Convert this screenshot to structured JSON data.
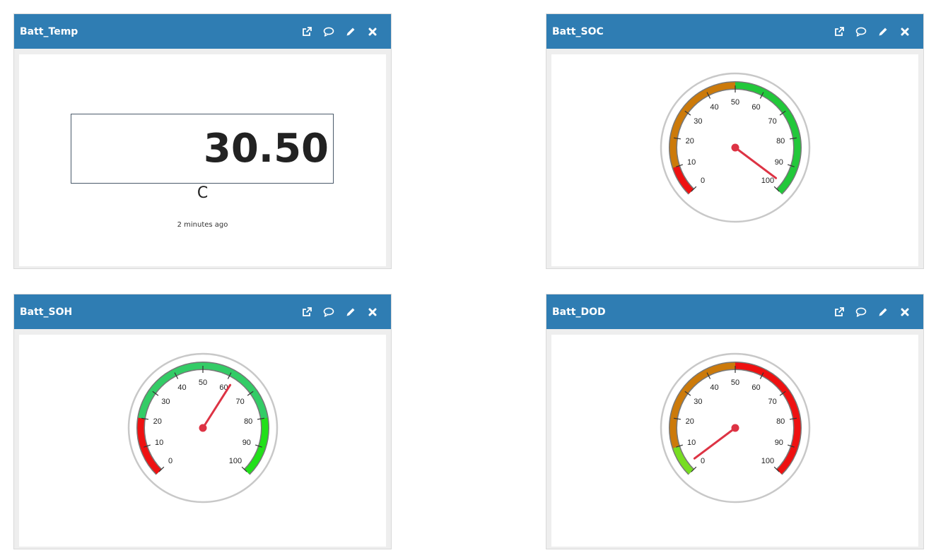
{
  "widgets": {
    "temp": {
      "title": "Batt_Temp",
      "value": "30.50",
      "unit": "C",
      "updated": "2 minutes ago"
    },
    "soc": {
      "title": "Batt_SOC",
      "gauge": {
        "min": 0,
        "max": 100,
        "value": 97,
        "ticks": [
          "0",
          "10",
          "20",
          "30",
          "40",
          "50",
          "60",
          "70",
          "80",
          "90",
          "100"
        ],
        "bands": [
          {
            "from": 0,
            "to": 10,
            "color": "#ee1111"
          },
          {
            "from": 10,
            "to": 50,
            "color": "#cc7a0a"
          },
          {
            "from": 50,
            "to": 100,
            "color": "#22c83a"
          }
        ]
      }
    },
    "soh": {
      "title": "Batt_SOH",
      "gauge": {
        "min": 0,
        "max": 100,
        "value": 62,
        "ticks": [
          "0",
          "10",
          "20",
          "30",
          "40",
          "50",
          "60",
          "70",
          "80",
          "90",
          "100"
        ],
        "bands": [
          {
            "from": 0,
            "to": 20,
            "color": "#ee1111"
          },
          {
            "from": 20,
            "to": 80,
            "color": "#33cc66"
          },
          {
            "from": 80,
            "to": 100,
            "color": "#22e01a"
          }
        ]
      }
    },
    "dod": {
      "title": "Batt_DOD",
      "gauge": {
        "min": 0,
        "max": 100,
        "value": 3,
        "ticks": [
          "0",
          "10",
          "20",
          "30",
          "40",
          "50",
          "60",
          "70",
          "80",
          "90",
          "100"
        ],
        "bands": [
          {
            "from": 0,
            "to": 10,
            "color": "#77dd22"
          },
          {
            "from": 10,
            "to": 50,
            "color": "#cc7a0a"
          },
          {
            "from": 50,
            "to": 100,
            "color": "#ee1111"
          }
        ]
      }
    }
  },
  "actions": [
    {
      "icon": "external-link-icon"
    },
    {
      "icon": "comment-icon"
    },
    {
      "icon": "edit-pencil-icon"
    },
    {
      "icon": "close-icon"
    }
  ],
  "colors": {
    "header": "#2f7db3",
    "needle": "#dd3344",
    "gauge_bezel": "#c8c8c8",
    "gauge_track": "#777777"
  }
}
